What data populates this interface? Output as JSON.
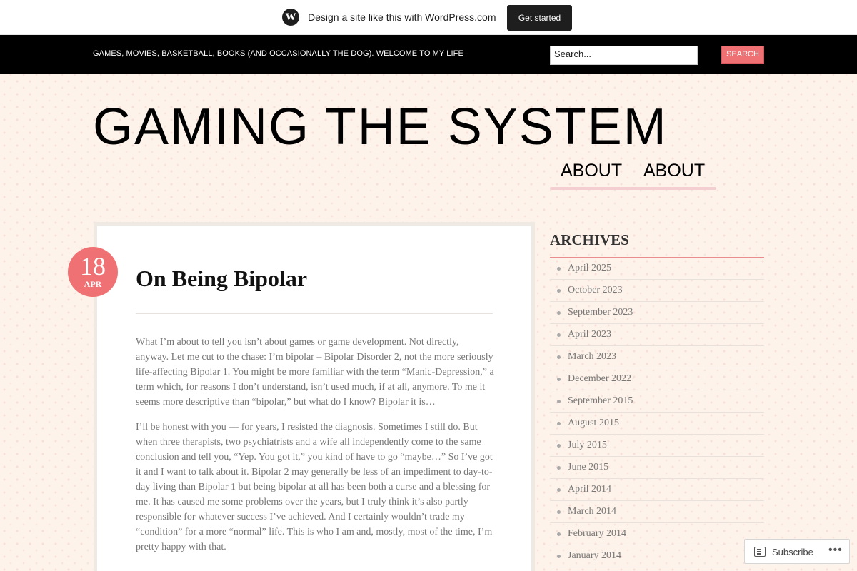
{
  "wp_banner": {
    "logo": "W",
    "text": "Design a site like this with WordPress.com",
    "cta": "Get started"
  },
  "topbar": {
    "tagline": "GAMES, MOVIES, BASKETBALL, BOOKS (AND OCCASIONALLY THE DOG). WELCOME TO MY LIFE",
    "search_value": "Search...",
    "search_button": "SEARCH"
  },
  "site": {
    "title": "GAMING THE SYSTEM",
    "nav": [
      "ABOUT",
      "ABOUT"
    ]
  },
  "post": {
    "date_day": "18",
    "date_month": "APR",
    "title": "On Being Bipolar",
    "paragraphs": [
      "What I’m about to tell you isn’t about games or game development. Not directly, anyway. Let me cut to the chase: I’m bipolar – Bipolar Disorder 2, not the more seriously life-affecting Bipolar 1. You might be more familiar with the term “Manic-Depression,” a term which, for reasons I don’t understand, isn’t used much, if at all, anymore. To me it seems more descriptive than “bipolar,” but what do I know? Bipolar it is…",
      "I’ll be honest with you — for years, I resisted the diagnosis. Sometimes I still do. But when three therapists, two psychiatrists and a wife all independently come to the same conclusion and tell you, “Yep. You got it,” you kind of have to go “maybe…” So I’ve got it and I want to talk about it. Bipolar 2 may generally be less of an impediment to day-to-day living than Bipolar 1 but being bipolar at all has been both a curse and a blessing for me. It has caused me some problems over the years, but I truly think it’s also partly responsible for whatever success I’ve achieved. And I certainly wouldn’t trade my “condition” for a more “normal” life. This is who I am and, mostly, most of the time, I’m pretty happy with that."
    ]
  },
  "sidebar": {
    "archives_title": "ARCHIVES",
    "archives": [
      "April 2025",
      "October 2023",
      "September 2023",
      "April 2023",
      "March 2023",
      "December 2022",
      "September 2015",
      "August 2015",
      "July 2015",
      "June 2015",
      "April 2014",
      "March 2014",
      "February 2014",
      "January 2014"
    ]
  },
  "subscribe": {
    "label": "Subscribe",
    "more": "•••"
  },
  "colors": {
    "accent": "#f07173",
    "background": "#fdf3ea"
  }
}
